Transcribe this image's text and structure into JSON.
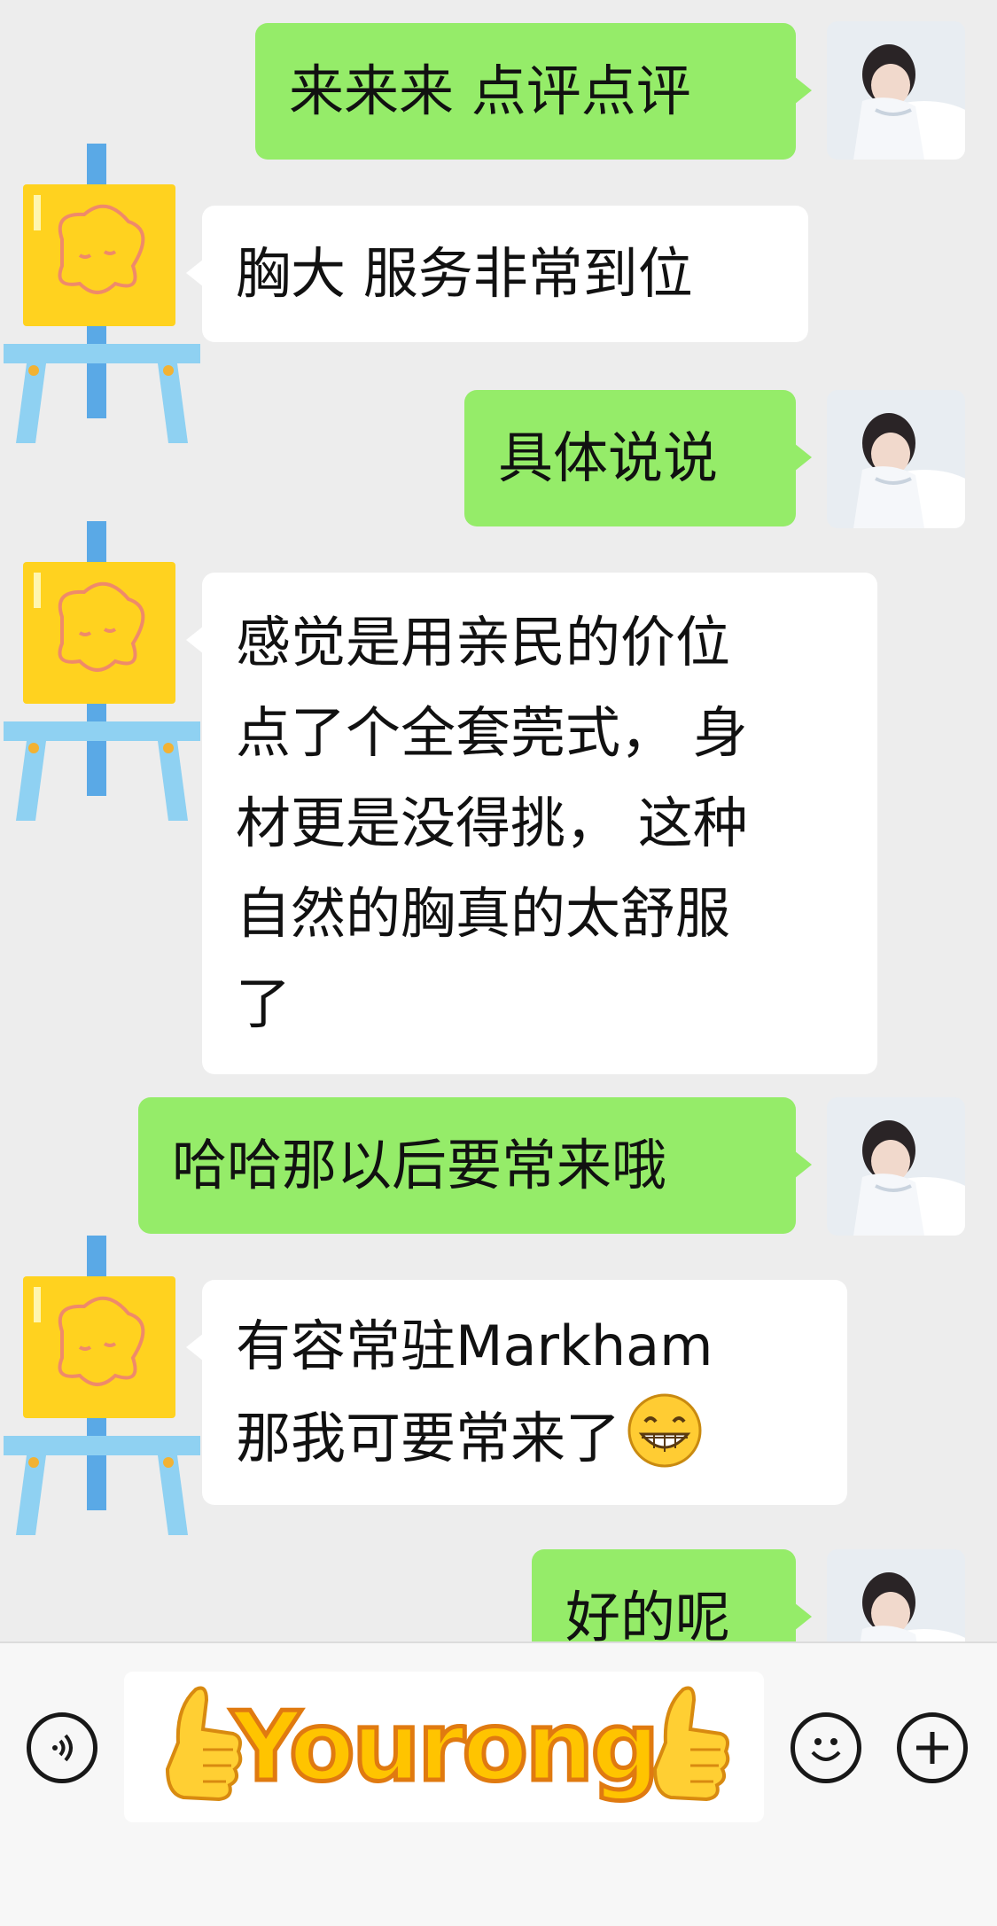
{
  "messages": [
    {
      "side": "out",
      "text": "来来来 点评点评"
    },
    {
      "side": "in",
      "text": "胸大 服务非常到位"
    },
    {
      "side": "out",
      "text": "具体说说"
    },
    {
      "side": "in",
      "lines": [
        "感觉是用亲民的价位",
        "点了个全套莞式， 身",
        "材更是没得挑， 这种",
        "自然的胸真的太舒服",
        "了"
      ]
    },
    {
      "side": "out",
      "text": "哈哈那以后要常来哦"
    },
    {
      "side": "in",
      "lines": [
        "有容常驻Markham",
        "那我可要常来了"
      ],
      "emoji": "grinning-face"
    },
    {
      "side": "out",
      "text": "好的呢"
    }
  ],
  "input_bar": {
    "text_field_value": "Yourong",
    "left_button_icon": "voice-icon",
    "right_button_icons": [
      "emoji-icon",
      "plus-icon"
    ]
  },
  "colors": {
    "chat_background": "#ededed",
    "outgoing_bubble": "#95ec69",
    "incoming_bubble": "#ffffff",
    "brand_text": "#ffc400"
  }
}
